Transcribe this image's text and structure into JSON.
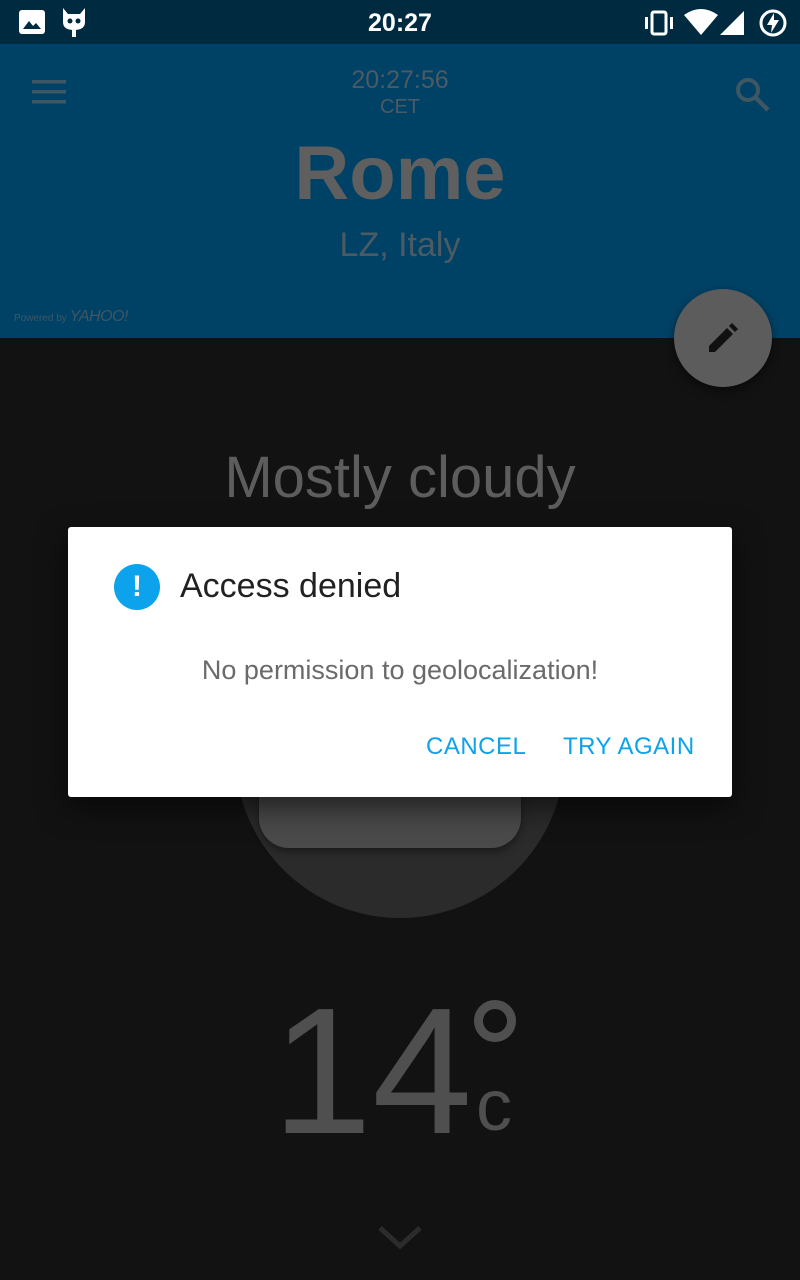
{
  "status_bar": {
    "time": "20:27",
    "icons": [
      "image-icon",
      "android-cat-icon",
      "vibrate-icon",
      "wifi-icon",
      "signal-icon",
      "charging-icon"
    ]
  },
  "header": {
    "clock_time": "20:27:56",
    "timezone": "CET",
    "city": "Rome",
    "region": "LZ, Italy",
    "powered_by": "Powered by",
    "provider": "YAHOO!"
  },
  "weather": {
    "condition": "Mostly cloudy",
    "temperature": "14",
    "unit": "c"
  },
  "dialog": {
    "title": "Access denied",
    "message": "No permission to geolocalization!",
    "cancel_label": "CANCEL",
    "retry_label": "TRY AGAIN",
    "icon_glyph": "!"
  },
  "colors": {
    "status_bar": "#002a40",
    "header": "#004266",
    "accent": "#0ca3ec",
    "background": "#121212"
  }
}
